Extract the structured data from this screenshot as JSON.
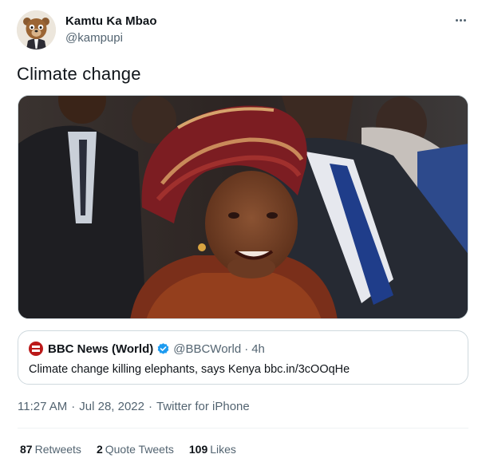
{
  "author": {
    "display_name": "Kamtu Ka Mbao",
    "handle": "@kampupi"
  },
  "tweet": {
    "text": "Climate change"
  },
  "quoted_tweet": {
    "display_name": "BBC News (World)",
    "handle": "@BBCWorld",
    "dot": "·",
    "time": "4h",
    "text": "Climate change killing elephants, says Kenya bbc.in/3cOOqHe"
  },
  "meta": {
    "time": "11:27 AM",
    "date": "Jul 28, 2022",
    "source": "Twitter for iPhone",
    "sep": "·"
  },
  "stats": {
    "retweets_count": "87",
    "retweets_label": "Retweets",
    "quotes_count": "2",
    "quotes_label": "Quote Tweets",
    "likes_count": "109",
    "likes_label": "Likes"
  },
  "colors": {
    "text_primary": "#0f1419",
    "text_secondary": "#536471",
    "border": "#cfd9de",
    "verified": "#1d9bf0",
    "bbc_red": "#bb1919"
  },
  "icons": {
    "more": "more-horizontal-icon",
    "verified": "verified-badge-icon",
    "bbc": "bbc-news-logo-icon"
  }
}
